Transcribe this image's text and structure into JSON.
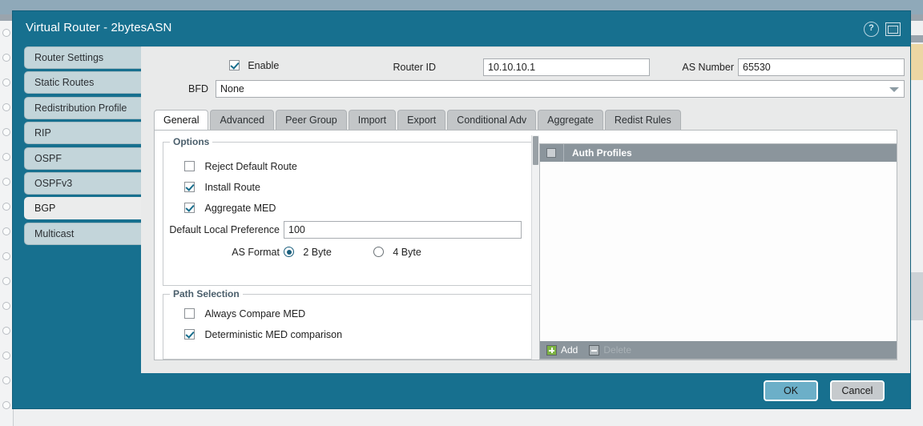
{
  "window": {
    "title": "Virtual Router - 2bytesASN",
    "help_icon": "help-circle-icon",
    "restore_icon": "restore-window-icon",
    "help_glyph": "?",
    "accent_color": "#17708f",
    "ok_color": "#6cafc8"
  },
  "sidebar": {
    "items": [
      {
        "label": "Router Settings",
        "active": false
      },
      {
        "label": "Static Routes",
        "active": false
      },
      {
        "label": "Redistribution Profile",
        "active": false
      },
      {
        "label": "RIP",
        "active": false
      },
      {
        "label": "OSPF",
        "active": false
      },
      {
        "label": "OSPFv3",
        "active": false
      },
      {
        "label": "BGP",
        "active": true
      },
      {
        "label": "Multicast",
        "active": false
      }
    ]
  },
  "header_form": {
    "enable_label": "Enable",
    "enable_checked": true,
    "router_id_label": "Router ID",
    "router_id_value": "10.10.10.1",
    "as_number_label": "AS Number",
    "as_number_value": "65530",
    "bfd_label": "BFD",
    "bfd_value": "None"
  },
  "tabs": [
    {
      "label": "General",
      "active": true
    },
    {
      "label": "Advanced",
      "active": false
    },
    {
      "label": "Peer Group",
      "active": false
    },
    {
      "label": "Import",
      "active": false
    },
    {
      "label": "Export",
      "active": false
    },
    {
      "label": "Conditional Adv",
      "active": false
    },
    {
      "label": "Aggregate",
      "active": false
    },
    {
      "label": "Redist Rules",
      "active": false
    }
  ],
  "options": {
    "legend": "Options",
    "reject_default_route_label": "Reject Default Route",
    "reject_default_route_checked": false,
    "install_route_label": "Install Route",
    "install_route_checked": true,
    "aggregate_med_label": "Aggregate MED",
    "aggregate_med_checked": true,
    "default_local_pref_label": "Default Local Preference",
    "default_local_pref_value": "100",
    "as_format_label": "AS Format",
    "as_format_option_1": "2 Byte",
    "as_format_option_2": "4 Byte",
    "as_format_selected": "2 Byte"
  },
  "path_selection": {
    "legend": "Path Selection",
    "always_compare_med_label": "Always Compare MED",
    "always_compare_med_checked": false,
    "deterministic_med_label": "Deterministic MED comparison",
    "deterministic_med_checked": true
  },
  "auth_profiles": {
    "header_title": "Auth Profiles",
    "rows": [],
    "add_label": "Add",
    "delete_label": "Delete",
    "delete_enabled": false
  },
  "footer": {
    "ok_label": "OK",
    "cancel_label": "Cancel"
  }
}
